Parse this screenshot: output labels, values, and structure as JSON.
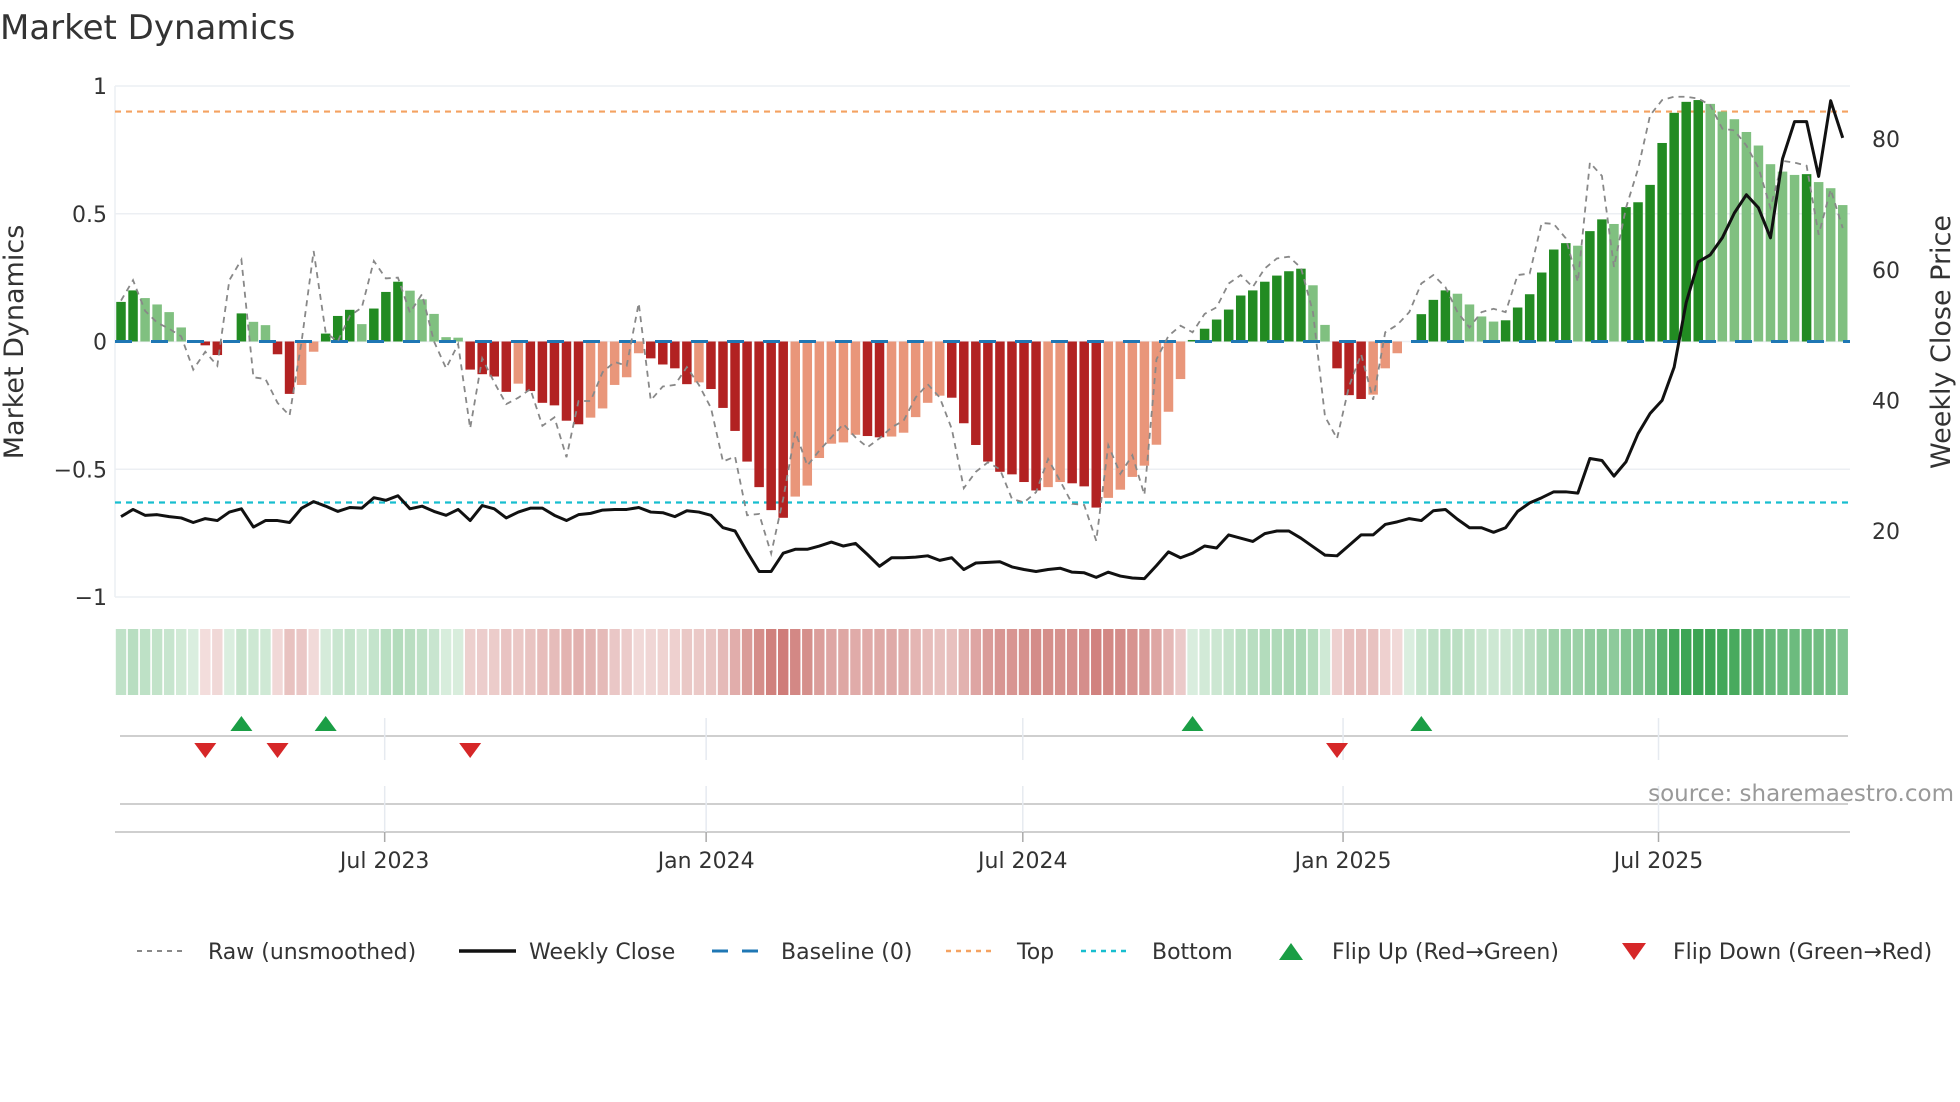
{
  "title": "Market Dynamics",
  "source": "source: sharemaestro.com",
  "colors": {
    "bar_strong_green": "#228b22",
    "bar_weak_green": "#80c080",
    "bar_strong_red": "#b22222",
    "bar_weak_red": "#e9967a",
    "raw": "#888888",
    "close": "#111111",
    "baseline": "#1f77b4",
    "top": "#f4a261",
    "bottom": "#17becf",
    "flip_up": "#1a9e45",
    "flip_down": "#d62728"
  },
  "legend": {
    "raw": "Raw (unsmoothed)",
    "close": "Weekly Close",
    "baseline": "Baseline (0)",
    "top": "Top",
    "bottom": "Bottom",
    "flip_up": "Flip Up (Red→Green)",
    "flip_down": "Flip Down (Green→Red)"
  },
  "chart_data": {
    "type": "bar",
    "title": "Market Dynamics",
    "ylabel": "Market Dynamics",
    "y2label": "Weekly Close Price",
    "ylim": [
      -1,
      1
    ],
    "y2lim": [
      0,
      90
    ],
    "y_ticks": [
      {
        "v": 1,
        "label": "1"
      },
      {
        "v": 0.5,
        "label": "0.5"
      },
      {
        "v": 0,
        "label": "0"
      },
      {
        "v": -0.5,
        "label": "−0.5"
      },
      {
        "v": -1,
        "label": "−1"
      }
    ],
    "y2_ticks": [
      {
        "v": 20,
        "label": "20"
      },
      {
        "v": 40,
        "label": "40"
      },
      {
        "v": 60,
        "label": "60"
      },
      {
        "v": 80,
        "label": "80"
      }
    ],
    "x_unit": "week index",
    "x_ticks": [
      {
        "week": 21.9,
        "label": "Jul 2023"
      },
      {
        "week": 48.6,
        "label": "Jan 2024"
      },
      {
        "week": 74.9,
        "label": "Jul 2024"
      },
      {
        "week": 101.5,
        "label": "Jan 2025"
      },
      {
        "week": 127.7,
        "label": "Jul 2025"
      }
    ],
    "top_level": 0.9,
    "bottom_level": -0.63,
    "baseline": 0,
    "grid": true,
    "legend_position": "bottom",
    "bar_values": [
      0.155,
      0.2,
      0.17,
      0.145,
      0.115,
      0.055,
      0,
      -0.015,
      -0.053,
      0,
      0.11,
      0.077,
      0.064,
      -0.05,
      -0.205,
      -0.17,
      -0.04,
      0.031,
      0.1,
      0.124,
      0.068,
      0.129,
      0.194,
      0.234,
      0.199,
      0.165,
      0.108,
      0.017,
      0.015,
      -0.11,
      -0.128,
      -0.137,
      -0.197,
      -0.165,
      -0.194,
      -0.24,
      -0.25,
      -0.31,
      -0.324,
      -0.298,
      -0.262,
      -0.17,
      -0.14,
      -0.046,
      -0.066,
      -0.09,
      -0.105,
      -0.167,
      -0.16,
      -0.186,
      -0.26,
      -0.35,
      -0.47,
      -0.57,
      -0.66,
      -0.69,
      -0.607,
      -0.564,
      -0.456,
      -0.4,
      -0.395,
      -0.365,
      -0.37,
      -0.375,
      -0.372,
      -0.357,
      -0.296,
      -0.24,
      -0.212,
      -0.22,
      -0.32,
      -0.405,
      -0.47,
      -0.51,
      -0.52,
      -0.55,
      -0.583,
      -0.57,
      -0.55,
      -0.555,
      -0.567,
      -0.65,
      -0.612,
      -0.58,
      -0.53,
      -0.486,
      -0.404,
      -0.275,
      -0.147,
      0.006,
      0.05,
      0.086,
      0.125,
      0.18,
      0.2,
      0.234,
      0.258,
      0.275,
      0.285,
      0.22,
      0.065,
      -0.105,
      -0.21,
      -0.225,
      -0.208,
      -0.105,
      -0.046,
      0,
      0.107,
      0.163,
      0.2,
      0.187,
      0.145,
      0.098,
      0.078,
      0.083,
      0.133,
      0.185,
      0.27,
      0.36,
      0.385,
      0.375,
      0.432,
      0.478,
      0.46,
      0.526,
      0.545,
      0.613,
      0.777,
      0.895,
      0.938,
      0.945,
      0.93,
      0.9,
      0.87,
      0.82,
      0.767,
      0.694,
      0.665,
      0.652,
      0.655,
      0.624,
      0.6,
      0.534
    ],
    "bar_shade_codes": "GGgggg.RR.GggRRrrGGGgGGGgggggRRRRrRRRRRrrrrrRRRRrRRRRRRRrrrrrrRRrrrrrRRRRRRRRrrRRRrrrrrrrGGGGGGGGGGggRRRrrr.GGGggggGGGGGGgGGgGGGGGGGggggggggGggg",
    "bar_shade_legend": {
      "G": "strong green",
      "g": "weak green",
      "R": "strong red",
      "r": "weak red",
      ".": "none"
    },
    "raw_values": [
      0.16,
      0.24,
      0.12,
      0.074,
      0.05,
      0.02,
      -0.11,
      -0.04,
      -0.095,
      0.24,
      0.32,
      -0.14,
      -0.147,
      -0.24,
      -0.29,
      0,
      0.354,
      0.035,
      0,
      0.1,
      0.133,
      0.315,
      0.247,
      0.25,
      0.113,
      0.185,
      0,
      -0.105,
      -0.01,
      -0.34,
      -0.066,
      -0.16,
      -0.245,
      -0.22,
      -0.186,
      -0.33,
      -0.297,
      -0.453,
      -0.233,
      -0.233,
      -0.12,
      -0.08,
      -0.095,
      0.15,
      -0.23,
      -0.176,
      -0.17,
      -0.1,
      -0.17,
      -0.26,
      -0.47,
      -0.45,
      -0.68,
      -0.675,
      -0.83,
      -0.616,
      -0.353,
      -0.486,
      -0.427,
      -0.375,
      -0.323,
      -0.375,
      -0.414,
      -0.379,
      -0.336,
      -0.31,
      -0.219,
      -0.167,
      -0.219,
      -0.342,
      -0.574,
      -0.51,
      -0.473,
      -0.5,
      -0.616,
      -0.63,
      -0.59,
      -0.46,
      -0.545,
      -0.635,
      -0.64,
      -0.78,
      -0.406,
      -0.518,
      -0.445,
      -0.6,
      -0.07,
      0.022,
      0.062,
      0.036,
      0.108,
      0.134,
      0.227,
      0.26,
      0.213,
      0.286,
      0.325,
      0.332,
      0.289,
      0.115,
      -0.294,
      -0.38,
      -0.175,
      -0.05,
      -0.228,
      0.036,
      0.065,
      0.115,
      0.227,
      0.26,
      0.213,
      0.115,
      0.055,
      0.115,
      0.128,
      0.115,
      0.26,
      0.266,
      0.464,
      0.46,
      0.404,
      0.233,
      0.7,
      0.648,
      0.292,
      0.523,
      0.675,
      0.885,
      0.945,
      0.958,
      0.958,
      0.951,
      0.925,
      0.833,
      0.826,
      0.767,
      0.68,
      0.523,
      0.707,
      0.7,
      0.688,
      0.418,
      0.595,
      0.444
    ],
    "weekly_close": [
      22.2,
      23.3,
      22.4,
      22.5,
      22.2,
      22.0,
      21.3,
      21.9,
      21.6,
      22.9,
      23.4,
      20.6,
      21.6,
      21.6,
      21.3,
      23.5,
      24.5,
      23.8,
      23.0,
      23.6,
      23.5,
      25.1,
      24.7,
      25.4,
      23.4,
      23.8,
      23.0,
      22.4,
      23.3,
      21.6,
      23.9,
      23.4,
      22.0,
      22.9,
      23.5,
      23.5,
      22.4,
      21.6,
      22.5,
      22.7,
      23.2,
      23.3,
      23.3,
      23.6,
      22.9,
      22.8,
      22.2,
      23.1,
      22.9,
      22.4,
      20.5,
      20.0,
      16.8,
      13.8,
      13.8,
      16.6,
      17.2,
      17.2,
      17.7,
      18.3,
      17.7,
      18.1,
      16.4,
      14.6,
      15.9,
      15.9,
      16.0,
      16.2,
      15.5,
      15.9,
      14.1,
      15.1,
      15.2,
      15.3,
      14.5,
      14.1,
      13.8,
      14.1,
      14.3,
      13.7,
      13.6,
      12.9,
      13.7,
      13.1,
      12.8,
      12.7,
      14.7,
      16.8,
      15.9,
      16.6,
      17.7,
      17.4,
      19.4,
      18.9,
      18.4,
      19.6,
      20.0,
      20.0,
      18.9,
      17.6,
      16.3,
      16.2,
      17.8,
      19.4,
      19.4,
      21.0,
      21.4,
      21.9,
      21.6,
      23.1,
      23.3,
      21.8,
      20.5,
      20.5,
      19.8,
      20.5,
      23.0,
      24.3,
      25.1,
      26.0,
      26.0,
      25.8,
      31.1,
      30.8,
      28.4,
      30.6,
      34.9,
      38.0,
      40.0,
      45.1,
      55.0,
      61.2,
      62.3,
      64.9,
      68.7,
      71.5,
      69.5,
      64.9,
      77.0,
      82.7,
      82.7,
      74.3,
      85.9,
      80.2
    ],
    "flip_up_weeks": [
      10,
      17,
      89,
      108
    ],
    "flip_down_weeks": [
      7,
      13,
      29,
      101
    ]
  }
}
